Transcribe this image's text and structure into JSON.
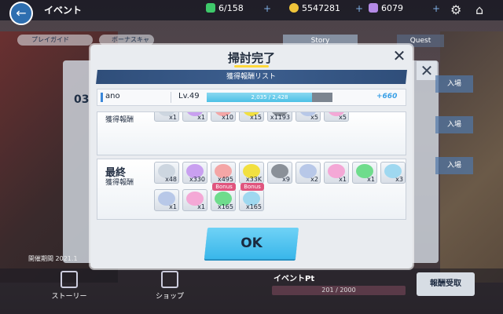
{
  "topbar": {
    "title": "イベント",
    "stamina": "6/158",
    "coins": "5547281",
    "gems": "6079"
  },
  "background": {
    "help_label": "プレイガイド",
    "bonus_label": "ボーナスキャ",
    "story_tab": "Story",
    "quest_tab": "Quest",
    "stage_number": "03",
    "date_text": "開催期間 2021.1",
    "side_buttons": [
      "入場",
      "入場",
      "入場"
    ],
    "nav_story": "ストーリー",
    "nav_shop": "ショップ",
    "event_pt_label": "イベントPt",
    "event_pt_value": "201 / 2000",
    "reward_button": "報酬受取"
  },
  "modal": {
    "title": "掃討完了",
    "list_header": "獲得報酬リスト",
    "character": {
      "name": "ano",
      "level": "Lv.49",
      "exp_text": "2,035 / 2,428",
      "exp_fraction": 0.838,
      "exp_gain": "+660"
    },
    "section1": {
      "label": "獲得報酬",
      "counts": [
        "x1",
        "x1",
        "x10",
        "x15",
        "x1193",
        "x5",
        "x5"
      ]
    },
    "section2": {
      "big_label": "最終",
      "label": "獲得報酬",
      "row1": [
        "x48",
        "x330",
        "x495",
        "x33K",
        "x9",
        "x2",
        "x1",
        "x1",
        "x3"
      ],
      "row2": [
        "x1",
        "x1",
        "x165",
        "x165"
      ],
      "bonus_tag": "Bonus"
    },
    "ok_label": "OK"
  },
  "colors": {
    "accent_blue": "#39b6ea",
    "header_navy": "#2f4e7a",
    "bonus_pink": "#e0557e",
    "title_underline": "#ffd83a"
  }
}
